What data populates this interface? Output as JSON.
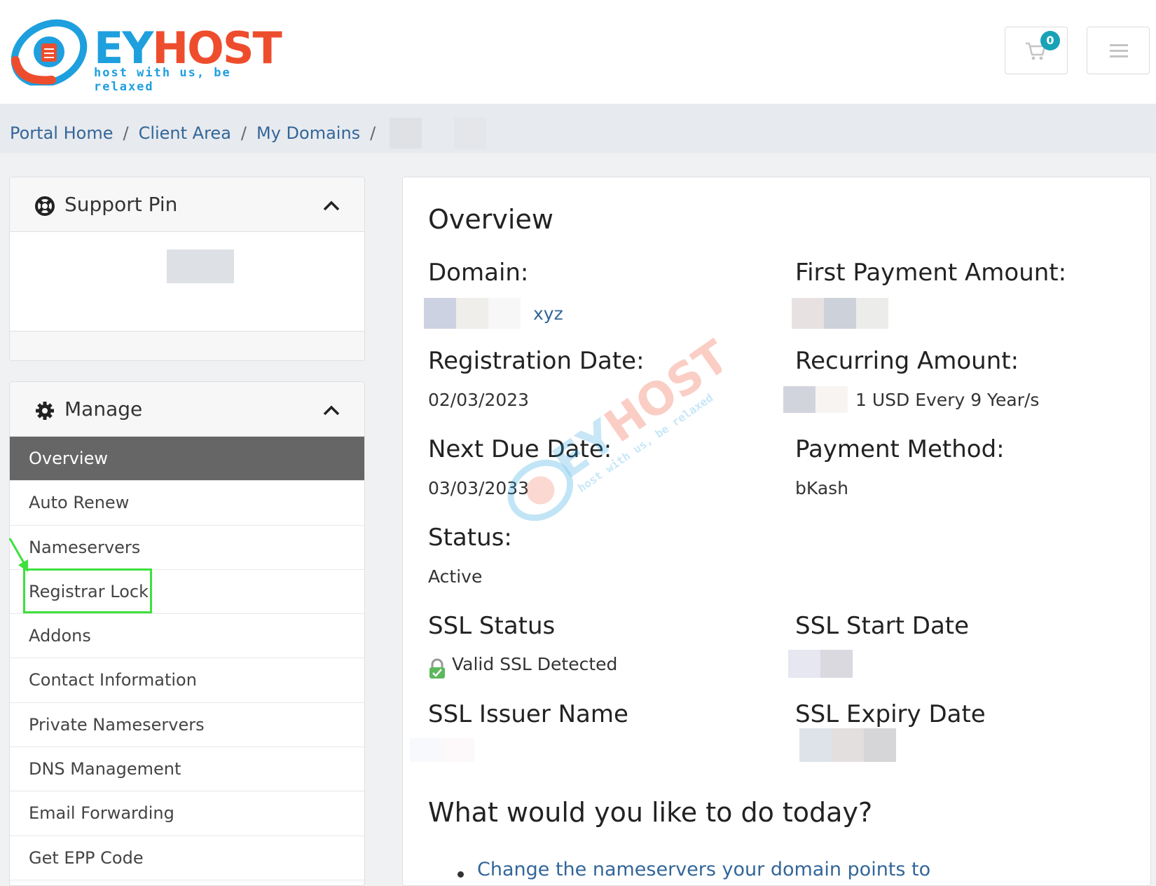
{
  "brand": {
    "name_part1": "EY",
    "name_part2": "HOST",
    "tagline": "host with us, be relaxed"
  },
  "header": {
    "cart_count": "0"
  },
  "breadcrumb": {
    "items": [
      "Portal Home",
      "Client Area",
      "My Domains"
    ],
    "separator": "/"
  },
  "sidebar": {
    "support_panel": {
      "title": "Support Pin"
    },
    "manage_panel": {
      "title": "Manage",
      "items": [
        {
          "label": "Overview",
          "active": true
        },
        {
          "label": "Auto Renew"
        },
        {
          "label": "Nameservers"
        },
        {
          "label": "Registrar Lock"
        },
        {
          "label": "Addons"
        },
        {
          "label": "Contact Information"
        },
        {
          "label": "Private Nameservers"
        },
        {
          "label": "DNS Management"
        },
        {
          "label": "Email Forwarding"
        },
        {
          "label": "Get EPP Code"
        }
      ]
    }
  },
  "overview": {
    "title": "Overview",
    "domain_label": "Domain:",
    "domain_value_suffix": "xyz",
    "first_payment_label": "First Payment Amount:",
    "registration_date_label": "Registration Date:",
    "registration_date": "02/03/2023",
    "recurring_label": "Recurring Amount:",
    "recurring_value": "1 USD Every 9 Year/s",
    "next_due_label": "Next Due Date:",
    "next_due_date": "03/03/2033",
    "payment_method_label": "Payment Method:",
    "payment_method": "bKash",
    "status_label": "Status:",
    "status": "Active",
    "ssl_status_label": "SSL Status",
    "ssl_status": "Valid SSL Detected",
    "ssl_start_label": "SSL Start Date",
    "ssl_issuer_label": "SSL Issuer Name",
    "ssl_expiry_label": "SSL Expiry Date"
  },
  "actions": {
    "title": "What would you like to do today?",
    "items": [
      "Change the nameservers your domain points to"
    ]
  },
  "colors": {
    "accent_blue": "#1e9fde",
    "accent_orange": "#ee4d2d",
    "link": "#336699",
    "highlight": "#3ee03e"
  }
}
